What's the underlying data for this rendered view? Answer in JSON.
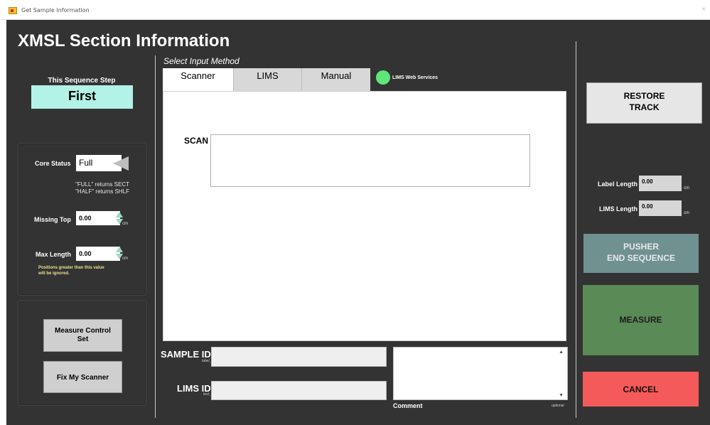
{
  "window": {
    "title": "Get Sample Information",
    "close_glyph": "×"
  },
  "heading": "XMSL Section Information",
  "sequence": {
    "label": "This Sequence Step",
    "value": "First"
  },
  "core_status": {
    "label": "Core Status",
    "value": "Full",
    "hint_line1": "\"FULL\" returns SECT",
    "hint_line2": "\"HALF\" returns SHLF"
  },
  "missing_top": {
    "label": "Missing Top",
    "value": "0.00",
    "unit": "cm"
  },
  "max_length": {
    "label": "Max Length",
    "value": "0.00",
    "unit": "cm",
    "note_line1": "Positions greater than this value",
    "note_line2": "will be ignored."
  },
  "buttons": {
    "measure_control_line1": "Measure Control",
    "measure_control_line2": "Set",
    "fix_scanner": "Fix My Scanner",
    "restore_line1": "RESTORE",
    "restore_line2": "TRACK",
    "pusher_line1": "PUSHER",
    "pusher_line2": "END SEQUENCE",
    "measure": "MEASURE",
    "cancel": "CANCEL"
  },
  "input_method": {
    "label": "Select Input Method",
    "tabs": [
      {
        "label": "Scanner",
        "active": true
      },
      {
        "label": "LIMS",
        "active": false
      },
      {
        "label": "Manual",
        "active": false
      }
    ],
    "led_label": "LIMS Web Services",
    "led_color": "#5ee67a"
  },
  "scanner": {
    "scan_label": "SCAN",
    "scan_value": ""
  },
  "sample_id": {
    "label": "SAMPLE ID",
    "sublabel": "label_id",
    "value": ""
  },
  "lims_id": {
    "label": "LIMS ID",
    "sublabel": "text_id",
    "value": ""
  },
  "comment": {
    "label": "Comment",
    "optional": "optional",
    "value": ""
  },
  "label_length": {
    "label": "Label Length",
    "value": "0.00",
    "unit": "cm"
  },
  "lims_length": {
    "label": "LIMS Length",
    "value": "0.00",
    "unit": "cm"
  }
}
